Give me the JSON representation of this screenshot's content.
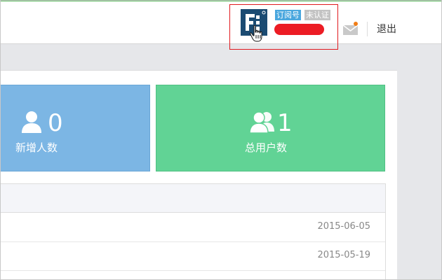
{
  "header": {
    "account": {
      "avatar_icon": "building-logo-icon",
      "badges": {
        "subscription": "订阅号",
        "verification": "未认证"
      },
      "name_redacted_color": "#ec1c24"
    },
    "mail_icon": "mail-icon",
    "logout_label": "退出",
    "accent_color": "#58b85c"
  },
  "stats": [
    {
      "icon": "user-icon",
      "value": "0",
      "label": "新增人数",
      "color": "#7cb6e4"
    },
    {
      "icon": "users-icon",
      "value": "1",
      "label": "总用户数",
      "color": "#61d395"
    }
  ],
  "table": {
    "rows": [
      {
        "date": "2015-06-05"
      },
      {
        "date": "2015-05-19"
      }
    ]
  }
}
